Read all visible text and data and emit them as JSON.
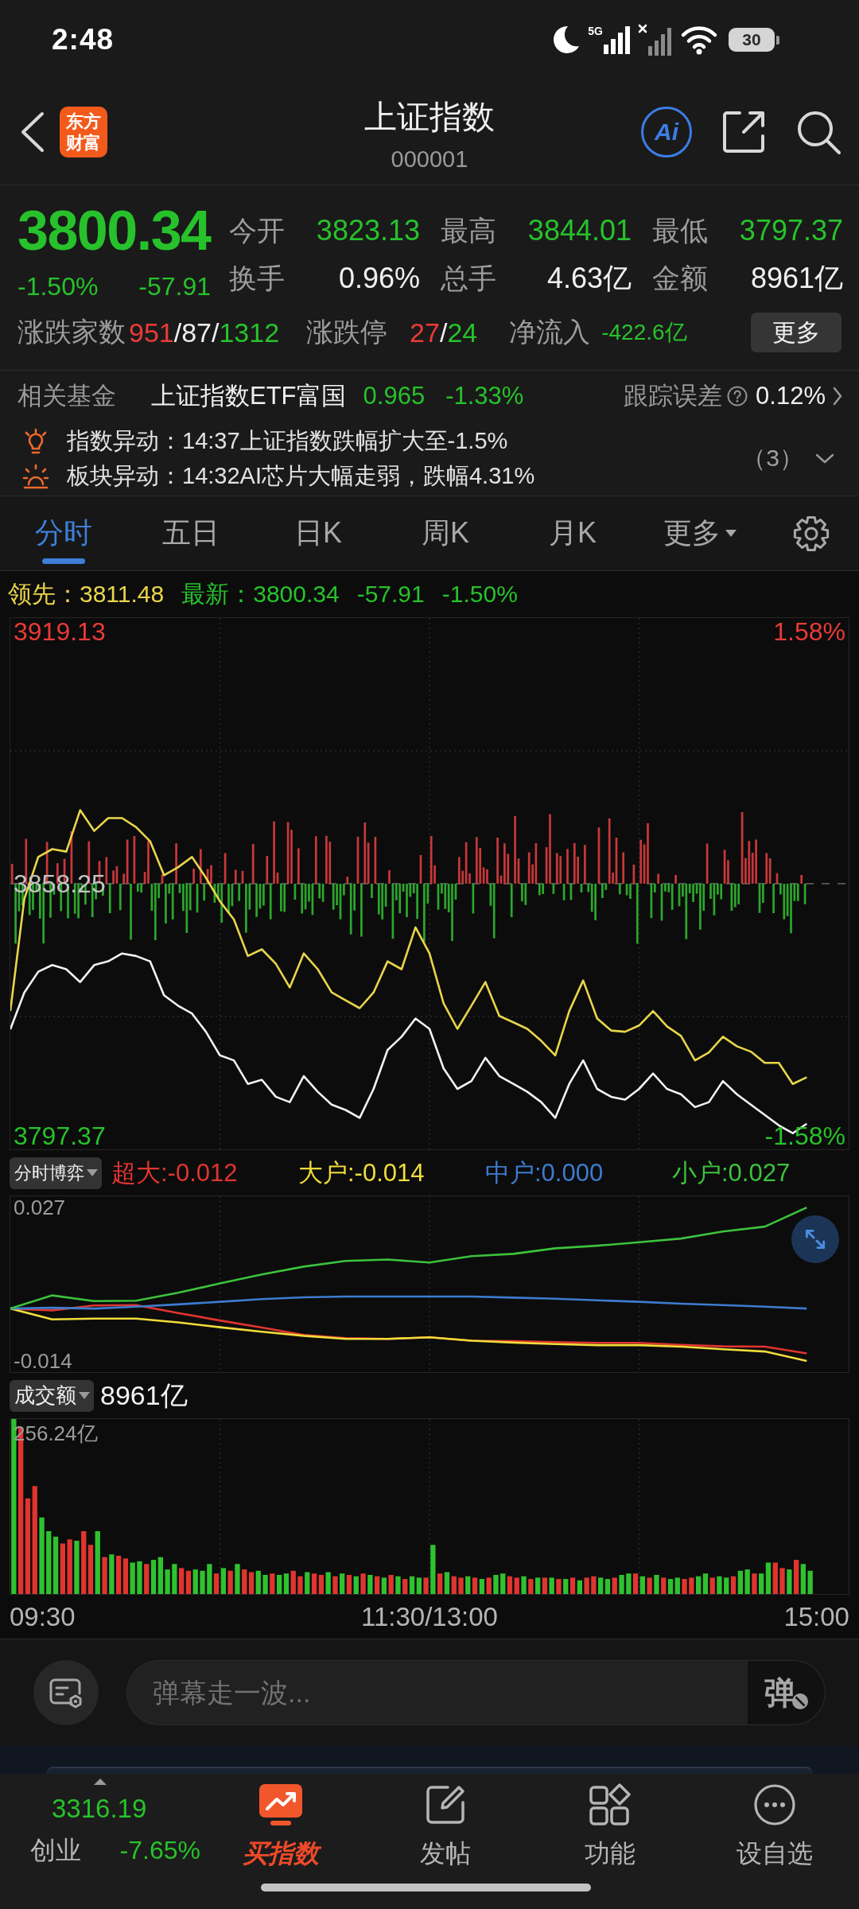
{
  "status_bar": {
    "time": "2:48",
    "network": "5G",
    "battery": "30"
  },
  "header": {
    "logo_lines": [
      "东方",
      "财富"
    ],
    "title": "上证指数",
    "code": "000001",
    "ai_label": "Ai"
  },
  "quote": {
    "price": "3800.34",
    "change_pct": "-1.50%",
    "change": "-57.91",
    "falling": true,
    "stats": [
      {
        "label": "今开",
        "value": "3823.13",
        "color": "#27c22b"
      },
      {
        "label": "最高",
        "value": "3844.01",
        "color": "#27c22b"
      },
      {
        "label": "最低",
        "value": "3797.37",
        "color": "#27c22b"
      },
      {
        "label": "换手",
        "value": "0.96%",
        "color": "#f0f0f0"
      },
      {
        "label": "总手",
        "value": "4.63亿",
        "color": "#f0f0f0"
      },
      {
        "label": "金额",
        "value": "8961亿",
        "color": "#f0f0f0"
      }
    ],
    "breadth": {
      "label": "涨跌家数",
      "parts": [
        {
          "text": "951",
          "color": "#ea3b36"
        },
        {
          "text": "/87/",
          "color": "#f0f0f0"
        },
        {
          "text": "1312",
          "color": "#27c22b"
        }
      ]
    },
    "limits": {
      "label": "涨跌停",
      "parts": [
        {
          "text": "27",
          "color": "#ea3b36"
        },
        {
          "text": "/",
          "color": "#f0f0f0"
        },
        {
          "text": "24",
          "color": "#27c22b"
        }
      ]
    },
    "net_inflow": {
      "label": "净流入",
      "value": "-422.6亿",
      "falling": true
    },
    "more_button": "更多"
  },
  "related_fund": {
    "label": "相关基金",
    "name": "上证指数ETF富国",
    "price": "0.965",
    "change": "-1.33%",
    "falling": true,
    "tracking_label": "跟踪误差",
    "tracking_value": "0.12%"
  },
  "news": {
    "items": [
      {
        "kind": "bulb",
        "text": "指数异动：14:37上证指数跌幅扩大至-1.5%"
      },
      {
        "kind": "sun",
        "text": "板块异动：14:32AI芯片大幅走弱，跌幅4.31%"
      }
    ],
    "count": "（3）"
  },
  "tabs": [
    {
      "label": "分时",
      "kind": "tab",
      "selected": true
    },
    {
      "label": "五日",
      "kind": "tab",
      "selected": false
    },
    {
      "label": "日K",
      "kind": "tab",
      "selected": false
    },
    {
      "label": "周K",
      "kind": "tab",
      "selected": false
    },
    {
      "label": "月K",
      "kind": "tab",
      "selected": false
    },
    {
      "label": "更多",
      "kind": "menu",
      "selected": false
    }
  ],
  "price_chart": {
    "legend": [
      {
        "text": "领先：3811.48",
        "color": "#e9d54a"
      },
      {
        "text": "最新：3800.34",
        "color": "#27c22b"
      },
      {
        "text": "-57.91",
        "color": "#27c22b"
      },
      {
        "text": "-1.50%",
        "color": "#27c22b"
      }
    ],
    "right_labels": [
      "1.58%",
      "-1.58%"
    ],
    "chart_data": {
      "type": "line",
      "grid": true,
      "categories": [
        null,
        null,
        null,
        null,
        null,
        null,
        null,
        null,
        null,
        null,
        null,
        null,
        null,
        null,
        null,
        null,
        null,
        null,
        null,
        null,
        null,
        null,
        null,
        null,
        null,
        null,
        null,
        null,
        null,
        null,
        null,
        null,
        null,
        null,
        null,
        null,
        null,
        null,
        null,
        null,
        null,
        null,
        null,
        null,
        null,
        null,
        null,
        null,
        null,
        null,
        null,
        null,
        null,
        null,
        null,
        null,
        null,
        null,
        null,
        null,
        null
      ],
      "ylim": [
        3794.1,
        3922.4
      ],
      "yticks": [
        {
          "value": 3919.13,
          "label": "3919.13"
        },
        {
          "value": 3858.25,
          "label": "3858.25"
        },
        {
          "value": 3797.37,
          "label": "3797.37"
        }
      ],
      "series": [
        {
          "color": "#f2f2f2",
          "values": [
            3823.1,
            3832.0,
            3837.0,
            3838.6,
            3837.6,
            3834.5,
            3838.6,
            3839.5,
            3841.4,
            3840.8,
            3839.5,
            3831.3,
            3828.8,
            3826.9,
            3822.5,
            3816.8,
            3815.6,
            3809.9,
            3810.9,
            3806.8,
            3805.5,
            3811.8,
            3808.0,
            3804.9,
            3803.6,
            3801.7,
            3808.7,
            3818.1,
            3821.3,
            3825.7,
            3823.2,
            3813.7,
            3808.7,
            3810.6,
            3816.2,
            3811.8,
            3809.9,
            3808.0,
            3805.5,
            3801.7,
            3809.9,
            3815.6,
            3808.7,
            3806.8,
            3806.1,
            3808.7,
            3812.4,
            3808.7,
            3807.4,
            3804.3,
            3805.5,
            3810.6,
            3807.4,
            3804.9,
            3802.4,
            3799.9,
            3798.0,
            3800.3,
            null,
            null,
            null
          ]
        },
        {
          "color": "#e9d54a",
          "values": [
            3827.5,
            3854.6,
            3864.7,
            3866.6,
            3866.0,
            3876.0,
            3871.0,
            3874.1,
            3874.1,
            3871.9,
            3868.5,
            3860.3,
            3862.2,
            3864.7,
            3859.7,
            3854.0,
            3849.6,
            3840.8,
            3842.4,
            3838.9,
            3833.2,
            3841.4,
            3837.6,
            3832.0,
            3830.1,
            3828.2,
            3832.0,
            3839.5,
            3837.6,
            3847.7,
            3841.4,
            3829.4,
            3823.2,
            3828.8,
            3834.5,
            3826.3,
            3824.8,
            3823.2,
            3820.3,
            3816.8,
            3827.5,
            3834.9,
            3825.7,
            3822.8,
            3822.5,
            3824.0,
            3827.5,
            3823.8,
            3821.5,
            3815.6,
            3817.5,
            3821.3,
            3819.0,
            3817.7,
            3815.0,
            3815.0,
            3809.9,
            3811.5,
            null,
            null,
            null
          ]
        }
      ]
    }
  },
  "flow_chart": {
    "selector": "分时博弈",
    "legend": [
      "超大:-0.012",
      "大户:-0.014",
      "中户:0.000",
      "小户:0.027"
    ],
    "chart_data": {
      "type": "line",
      "grid": true,
      "categories": [
        null,
        null,
        null,
        null,
        null,
        null,
        null,
        null,
        null,
        null,
        null,
        null,
        null,
        null,
        null,
        null,
        null,
        null,
        null,
        null,
        null
      ],
      "ylim": [
        -0.017,
        0.03
      ],
      "yticks": [
        {
          "value": 0.027,
          "label": "0.027"
        },
        {
          "value": -0.014,
          "label": "-0.014"
        }
      ],
      "series": [
        {
          "color": "#e0352f",
          "values": [
            0,
            -0.0005,
            0.0008,
            0.0009,
            -0.0012,
            -0.0032,
            -0.0051,
            -0.0071,
            -0.0079,
            -0.0081,
            -0.0077,
            -0.0086,
            -0.0087,
            -0.009,
            -0.0092,
            -0.0092,
            -0.0097,
            -0.0101,
            -0.0102,
            -0.012,
            null
          ]
        },
        {
          "color": "#f0dc3a",
          "values": [
            0,
            -0.0029,
            -0.0027,
            -0.0027,
            -0.0037,
            -0.005,
            -0.0062,
            -0.0073,
            -0.0081,
            -0.0081,
            -0.0077,
            -0.0086,
            -0.0091,
            -0.0095,
            -0.0098,
            -0.0098,
            -0.0102,
            -0.0109,
            -0.0115,
            -0.014,
            null
          ]
        },
        {
          "color": "#3d7ccf",
          "values": [
            0,
            0.0002,
            0,
            0.0005,
            0.0011,
            0.0018,
            0.0025,
            0.003,
            0.0032,
            0.0032,
            0.0032,
            0.0032,
            0.0029,
            0.0026,
            0.0022,
            0.0018,
            0.0013,
            0.0009,
            0.0005,
            0,
            null
          ]
        },
        {
          "color": "#3cc23c",
          "values": [
            0,
            0.0035,
            0.002,
            0.0021,
            0.0042,
            0.0067,
            0.0091,
            0.0112,
            0.0127,
            0.0131,
            0.0123,
            0.014,
            0.0146,
            0.0161,
            0.0168,
            0.0177,
            0.0187,
            0.0206,
            0.0219,
            0.027,
            null
          ]
        }
      ]
    }
  },
  "volume_chart": {
    "selector": "成交额",
    "total": "8961亿",
    "max_label": "256.24亿",
    "time_axis": [
      "09:30",
      "11:30/13:00",
      "15:00"
    ]
  },
  "comment_bar": {
    "placeholder": "弹幕走一波...",
    "send_label": "弹"
  },
  "bottom_nav": {
    "index": {
      "value": "3316.19",
      "name": "创业",
      "change": "-7.65%",
      "falling": true
    },
    "items": [
      {
        "label": "买指数",
        "kind": "promo"
      },
      {
        "label": "发帖",
        "kind": "post"
      },
      {
        "label": "功能",
        "kind": "apps"
      },
      {
        "label": "设自选",
        "kind": "watch"
      }
    ]
  }
}
